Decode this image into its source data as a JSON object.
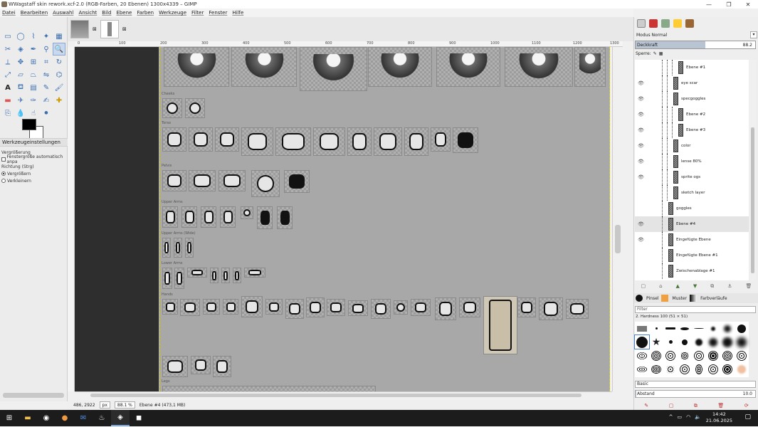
{
  "window": {
    "title": "WWagstaff skin rework.xcf-2.0 (RGB-Farben, 20 Ebenen) 1300x4339 – GIMP",
    "minimize": "—",
    "restore": "❐",
    "close": "✕"
  },
  "menu": [
    "Datei",
    "Bearbeiten",
    "Auswahl",
    "Ansicht",
    "Bild",
    "Ebene",
    "Farben",
    "Werkzeuge",
    "Filter",
    "Fenster",
    "Hilfe"
  ],
  "tool_options": {
    "tab_label": "Werkzeugeinstellungen",
    "title": "Vergrößerung",
    "auto_resize": "Fenstergröße automatisch anpa",
    "direction_label": "Richtung  (Strg)",
    "zoom_in": "Vergrößern",
    "zoom_out": "Verkleinern"
  },
  "image_tabs": {
    "close1": "⊠",
    "close2": "⊠"
  },
  "ruler": {
    "ticks": [
      "0",
      "100",
      "200",
      "300",
      "400",
      "500",
      "600",
      "700",
      "800",
      "900",
      "1000",
      "1100",
      "1200",
      "1300"
    ]
  },
  "canvas": {
    "sections": [
      "Cheeks",
      "Torso",
      "Pelvis",
      "Upper Arms",
      "Upper Arms (Wide)",
      "Lower Arms",
      "Hands",
      "Legs"
    ]
  },
  "status": {
    "coords": "486, 2922",
    "unit": "px",
    "zoom": "88.1 %",
    "layer": "Ebene #4 (473,1 MB)"
  },
  "layers_panel": {
    "mode_label": "Modus  Normal",
    "opacity_label": "Deckkraft",
    "opacity_value": "88.2",
    "opacity_fraction": 0.882,
    "lock_label": "Sperre:",
    "layers": [
      {
        "name": "Ebene #1",
        "visible": false,
        "depth": 3
      },
      {
        "name": "eye scar",
        "visible": true,
        "depth": 2
      },
      {
        "name": "specgoggles",
        "visible": true,
        "depth": 2
      },
      {
        "name": "Ebene #2",
        "visible": true,
        "depth": 3
      },
      {
        "name": "Ebene #3",
        "visible": true,
        "depth": 3
      },
      {
        "name": "color",
        "visible": true,
        "depth": 2
      },
      {
        "name": "lense 80%",
        "visible": true,
        "depth": 2
      },
      {
        "name": "sprite ogs",
        "visible": true,
        "depth": 2
      },
      {
        "name": "sketch layer",
        "visible": false,
        "depth": 2
      },
      {
        "name": "goggles",
        "visible": false,
        "depth": 1
      },
      {
        "name": "Ebene #4",
        "visible": true,
        "depth": 1,
        "active": true
      },
      {
        "name": "Eingefügte Ebene",
        "visible": true,
        "depth": 1
      },
      {
        "name": "Eingefügte Ebene #1",
        "visible": false,
        "depth": 1
      },
      {
        "name": "Zwischenablage #1",
        "visible": false,
        "depth": 1
      }
    ]
  },
  "brushes_panel": {
    "tabs": [
      "Pinsel",
      "Muster",
      "Farbverläufe"
    ],
    "filter_placeholder": "Filter",
    "brush_name": "2. Hardness 100 (51 × 51)",
    "preset": "Basic",
    "spacing_label": "Abstand",
    "spacing_value": "10.0"
  },
  "taskbar": {
    "time": "14:42",
    "date": "21.06.2025"
  }
}
